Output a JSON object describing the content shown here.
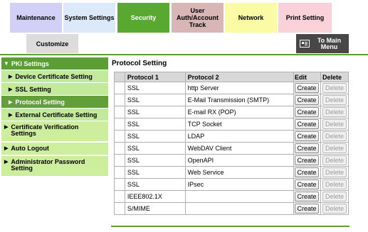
{
  "tabs": {
    "maintenance": "Maintenance",
    "system_settings": "System Settings",
    "security": "Security",
    "user_auth": "User Auth/Account Track",
    "network": "Network",
    "print_setting": "Print Setting",
    "customize": "Customize",
    "to_main_menu": "To Main Menu"
  },
  "sidebar": {
    "pki": "PKI Settings",
    "sub_items": [
      {
        "label": "Device Certificate Setting"
      },
      {
        "label": "SSL Setting"
      },
      {
        "label": "Protocol Setting"
      },
      {
        "label": "External Certificate Setting"
      }
    ],
    "top_items": [
      {
        "label": "Certificate Verification Settings"
      },
      {
        "label": "Auto Logout"
      },
      {
        "label": "Administrator Password Setting"
      }
    ]
  },
  "page": {
    "title": "Protocol Setting",
    "columns": [
      "Protocol 1",
      "Protocol 2",
      "Edit",
      "Delete"
    ],
    "button_create": "Create",
    "button_delete": "Delete",
    "rows": [
      {
        "p1": "SSL",
        "p2": "http Server"
      },
      {
        "p1": "SSL",
        "p2": "E-Mail Transmission (SMTP)"
      },
      {
        "p1": "SSL",
        "p2": "E-mail RX (POP)"
      },
      {
        "p1": "SSL",
        "p2": "TCP Socket"
      },
      {
        "p1": "SSL",
        "p2": "LDAP"
      },
      {
        "p1": "SSL",
        "p2": "WebDAV Client"
      },
      {
        "p1": "SSL",
        "p2": "OpenAPI"
      },
      {
        "p1": "SSL",
        "p2": "Web Service"
      },
      {
        "p1": "SSL",
        "p2": "IPsec"
      },
      {
        "p1": "IEEE802.1X",
        "p2": ""
      },
      {
        "p1": "S/MIME",
        "p2": ""
      }
    ]
  },
  "colors": {
    "security_tab": "#59a82f",
    "sidebar_active": "#629f39",
    "sidebar_sub": "#c3e99a",
    "sidebar_top": "#cdee9c"
  }
}
